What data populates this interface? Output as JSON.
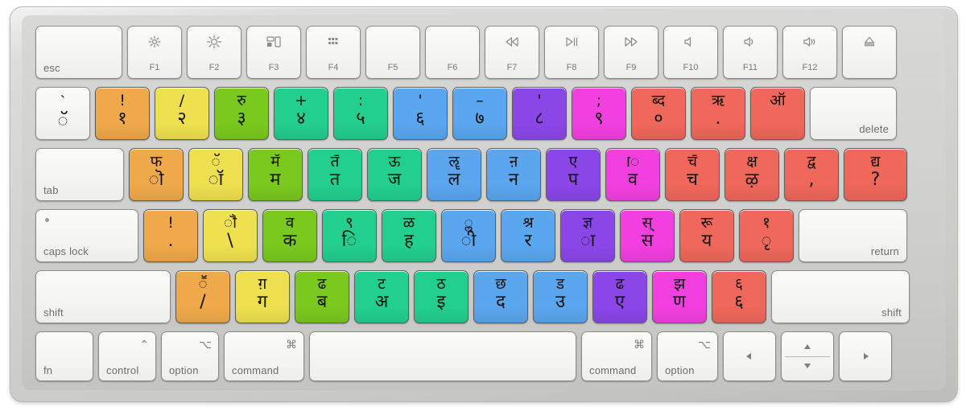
{
  "device": {
    "name": "Apple Magic Keyboard",
    "layout_name": "Devanagari / Marathi keycap stickers",
    "body_color": "#d2d2d0",
    "key_color": "#f5f5f2"
  },
  "palette": {
    "orange": "#efa94a",
    "yellow": "#efe04f",
    "green": "#79c91f",
    "teal": "#23cf8e",
    "blue": "#5aa6ef",
    "purple": "#8b46e8",
    "magenta": "#f23fdf",
    "red": "#f0675b"
  },
  "rows": {
    "function_row": [
      {
        "id": "esc",
        "main": "esc",
        "align": "bottom-left"
      },
      {
        "id": "f1",
        "label": "F1",
        "icon": "brightness-down-icon"
      },
      {
        "id": "f2",
        "label": "F2",
        "icon": "brightness-up-icon"
      },
      {
        "id": "f3",
        "label": "F3",
        "icon": "mission-control-icon"
      },
      {
        "id": "f4",
        "label": "F4",
        "icon": "launchpad-icon"
      },
      {
        "id": "f5",
        "label": "F5",
        "icon": "none"
      },
      {
        "id": "f6",
        "label": "F6",
        "icon": "none"
      },
      {
        "id": "f7",
        "label": "F7",
        "icon": "rewind-icon"
      },
      {
        "id": "f8",
        "label": "F8",
        "icon": "play-pause-icon"
      },
      {
        "id": "f9",
        "label": "F9",
        "icon": "fast-forward-icon"
      },
      {
        "id": "f10",
        "label": "F10",
        "icon": "volume-mute-icon"
      },
      {
        "id": "f11",
        "label": "F11",
        "icon": "volume-down-icon"
      },
      {
        "id": "f12",
        "label": "F12",
        "icon": "volume-up-icon"
      },
      {
        "id": "eject",
        "label": "",
        "icon": "eject-icon"
      }
    ],
    "number_row": [
      {
        "id": "backquote",
        "top": "`",
        "bot": "ॅ",
        "color": "white"
      },
      {
        "id": "digit1",
        "top": "!",
        "bot": "१",
        "color": "orange"
      },
      {
        "id": "digit2",
        "top": "/",
        "bot": "२",
        "color": "yellow"
      },
      {
        "id": "digit3",
        "top": "रु",
        "bot": "३",
        "color": "green"
      },
      {
        "id": "digit4",
        "top": "+",
        "bot": "४",
        "color": "teal"
      },
      {
        "id": "digit5",
        "top": ":",
        "bot": "५",
        "color": "teal"
      },
      {
        "id": "digit6",
        "top": "'",
        "bot": "६",
        "color": "blue"
      },
      {
        "id": "digit7",
        "top": "–",
        "bot": "७",
        "color": "blue"
      },
      {
        "id": "digit8",
        "top": "'",
        "bot": "८",
        "color": "purple"
      },
      {
        "id": "digit9",
        "top": ";",
        "bot": "९",
        "color": "magenta"
      },
      {
        "id": "digit0",
        "top": "ब्द",
        "bot": "०",
        "color": "red"
      },
      {
        "id": "minus",
        "top": "ऋ",
        "bot": ".",
        "color": "red"
      },
      {
        "id": "equal",
        "top": "ऑ",
        "bot": "",
        "color": "red"
      },
      {
        "id": "delete",
        "main": "delete",
        "align": "bottom-right"
      }
    ],
    "top_row": [
      {
        "id": "tab",
        "main": "tab",
        "align": "bottom-left"
      },
      {
        "id": "keyq",
        "top": "फ",
        "bot": "ॊ",
        "color": "orange"
      },
      {
        "id": "keyw",
        "top": "ॅ",
        "bot": "ॉ",
        "color": "yellow"
      },
      {
        "id": "keye",
        "top": "म̆",
        "bot": "म",
        "color": "green"
      },
      {
        "id": "keyr",
        "top": "त̄",
        "bot": "त",
        "color": "teal"
      },
      {
        "id": "keyt",
        "top": "ऊ",
        "bot": "ज",
        "color": "teal"
      },
      {
        "id": "keyy",
        "top": "ॡ",
        "bot": "ल",
        "color": "blue"
      },
      {
        "id": "keyu",
        "top": "ऩ",
        "bot": "न",
        "color": "blue"
      },
      {
        "id": "keyi",
        "top": "ए",
        "bot": "प",
        "color": "purple"
      },
      {
        "id": "keyo",
        "top": "ॎ",
        "bot": "व",
        "color": "magenta"
      },
      {
        "id": "keyp",
        "top": "च̄",
        "bot": "च",
        "color": "red"
      },
      {
        "id": "bracketleft",
        "top": "क्ष",
        "bot": "ऴ",
        "color": "red"
      },
      {
        "id": "bracketright",
        "top": "द्व",
        "bot": ",",
        "color": "red"
      },
      {
        "id": "backslash",
        "top": "द्य",
        "bot": "?",
        "color": "red"
      }
    ],
    "home_row": [
      {
        "id": "capslock",
        "main": "caps lock",
        "align": "bottom-left",
        "indicator": true
      },
      {
        "id": "keya",
        "top": "!",
        "bot": ".",
        "color": "orange"
      },
      {
        "id": "keys",
        "top": "ॏ",
        "bot": "\\",
        "color": "yellow"
      },
      {
        "id": "keyd",
        "top": "व",
        "bot": "क",
        "color": "green"
      },
      {
        "id": "keyf",
        "top": "९",
        "bot": "ि",
        "color": "teal"
      },
      {
        "id": "keyg",
        "top": "ळ",
        "bot": "ह",
        "color": "teal"
      },
      {
        "id": "keyh",
        "top": "ॢ",
        "bot": "ी",
        "color": "blue"
      },
      {
        "id": "keyj",
        "top": "श्र",
        "bot": "र",
        "color": "blue"
      },
      {
        "id": "keyk",
        "top": "ज्ञ",
        "bot": "ा",
        "color": "purple"
      },
      {
        "id": "keyl",
        "top": "स्",
        "bot": "स",
        "color": "magenta"
      },
      {
        "id": "semicolon",
        "top": "रू",
        "bot": "य",
        "color": "red"
      },
      {
        "id": "quote",
        "top": "१",
        "bot": "ृ",
        "color": "red"
      },
      {
        "id": "return",
        "main": "return",
        "align": "bottom-right"
      }
    ],
    "bottom_row": [
      {
        "id": "shiftleft",
        "main": "shift",
        "align": "bottom-left"
      },
      {
        "id": "keyz",
        "top": "ॕ",
        "bot": "/",
        "color": "orange"
      },
      {
        "id": "keyx",
        "top": "ग़",
        "bot": "ग",
        "color": "yellow"
      },
      {
        "id": "keyc",
        "top": "ढ",
        "bot": "ब",
        "color": "green"
      },
      {
        "id": "keyv",
        "top": "ट",
        "bot": "अ",
        "color": "teal"
      },
      {
        "id": "keyb",
        "top": "ठ",
        "bot": "इ",
        "color": "teal"
      },
      {
        "id": "keyn",
        "top": "छ",
        "bot": "द",
        "color": "blue"
      },
      {
        "id": "keym",
        "top": "ड",
        "bot": "उ",
        "color": "blue"
      },
      {
        "id": "comma",
        "top": "ढ",
        "bot": "ए",
        "color": "purple"
      },
      {
        "id": "period",
        "top": "झ",
        "bot": "ण",
        "color": "magenta"
      },
      {
        "id": "slash",
        "top": "६",
        "bot": "६",
        "color": "red"
      },
      {
        "id": "shiftright",
        "main": "shift",
        "align": "bottom-right"
      }
    ],
    "modifier_row": [
      {
        "id": "fn",
        "main": "fn",
        "sym": "",
        "align": "bottom-left"
      },
      {
        "id": "controlleft",
        "main": "control",
        "sym": "⌃",
        "align": "bottom-left"
      },
      {
        "id": "optionleft",
        "main": "option",
        "sym": "⌥",
        "align": "bottom-left"
      },
      {
        "id": "commandleft",
        "main": "command",
        "sym": "⌘",
        "align": "bottom-left"
      },
      {
        "id": "space",
        "main": "",
        "sym": "",
        "align": "bottom-left"
      },
      {
        "id": "commandright",
        "main": "command",
        "sym": "⌘",
        "align": "bottom-left"
      },
      {
        "id": "optionright",
        "main": "option",
        "sym": "⌥",
        "align": "bottom-left"
      },
      {
        "id": "arrowleft",
        "main": "",
        "icon": "arrow-left-icon"
      },
      {
        "id": "arrowupdown",
        "main": "",
        "icon": "arrow-up-down-icon"
      },
      {
        "id": "arrowright",
        "main": "",
        "icon": "arrow-right-icon"
      }
    ]
  }
}
